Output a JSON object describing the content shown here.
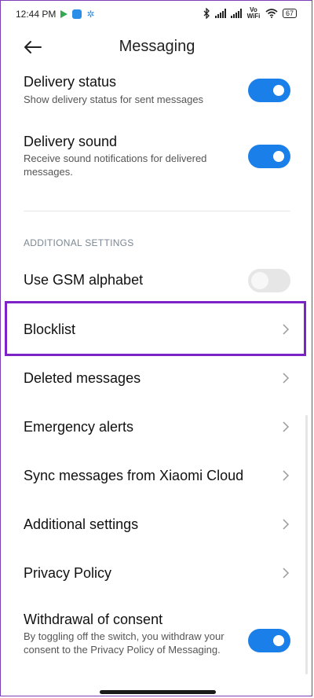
{
  "status_bar": {
    "time": "12:44 PM",
    "network_label": "Vo WiFi",
    "battery": "67"
  },
  "header": {
    "title": "Messaging"
  },
  "settings": {
    "delivery_status": {
      "label": "Delivery status",
      "description": "Show delivery status for sent messages",
      "enabled": true
    },
    "delivery_sound": {
      "label": "Delivery sound",
      "description": "Receive sound notifications for delivered messages.",
      "enabled": true
    },
    "section_title": "ADDITIONAL SETTINGS",
    "gsm_alphabet": {
      "label": "Use GSM alphabet",
      "enabled": false
    },
    "blocklist": {
      "label": "Blocklist"
    },
    "deleted_messages": {
      "label": "Deleted messages"
    },
    "emergency_alerts": {
      "label": "Emergency alerts"
    },
    "sync_cloud": {
      "label": "Sync messages from Xiaomi Cloud"
    },
    "additional_settings": {
      "label": "Additional settings"
    },
    "privacy_policy": {
      "label": "Privacy Policy"
    },
    "withdrawal": {
      "label": "Withdrawal of consent",
      "description": "By toggling off the switch, you withdraw your consent to the Privacy Policy of Messaging.",
      "enabled": true
    }
  },
  "colors": {
    "accent": "#1a7fe8",
    "highlight": "#7c22c7",
    "toggle_off": "#e6e6e6"
  },
  "icons": [
    "back-arrow-icon",
    "chevron-right-icon",
    "bluetooth-icon",
    "signal-icon",
    "wifi-icon",
    "battery-icon",
    "play-store-icon",
    "settings-gear-icon"
  ]
}
